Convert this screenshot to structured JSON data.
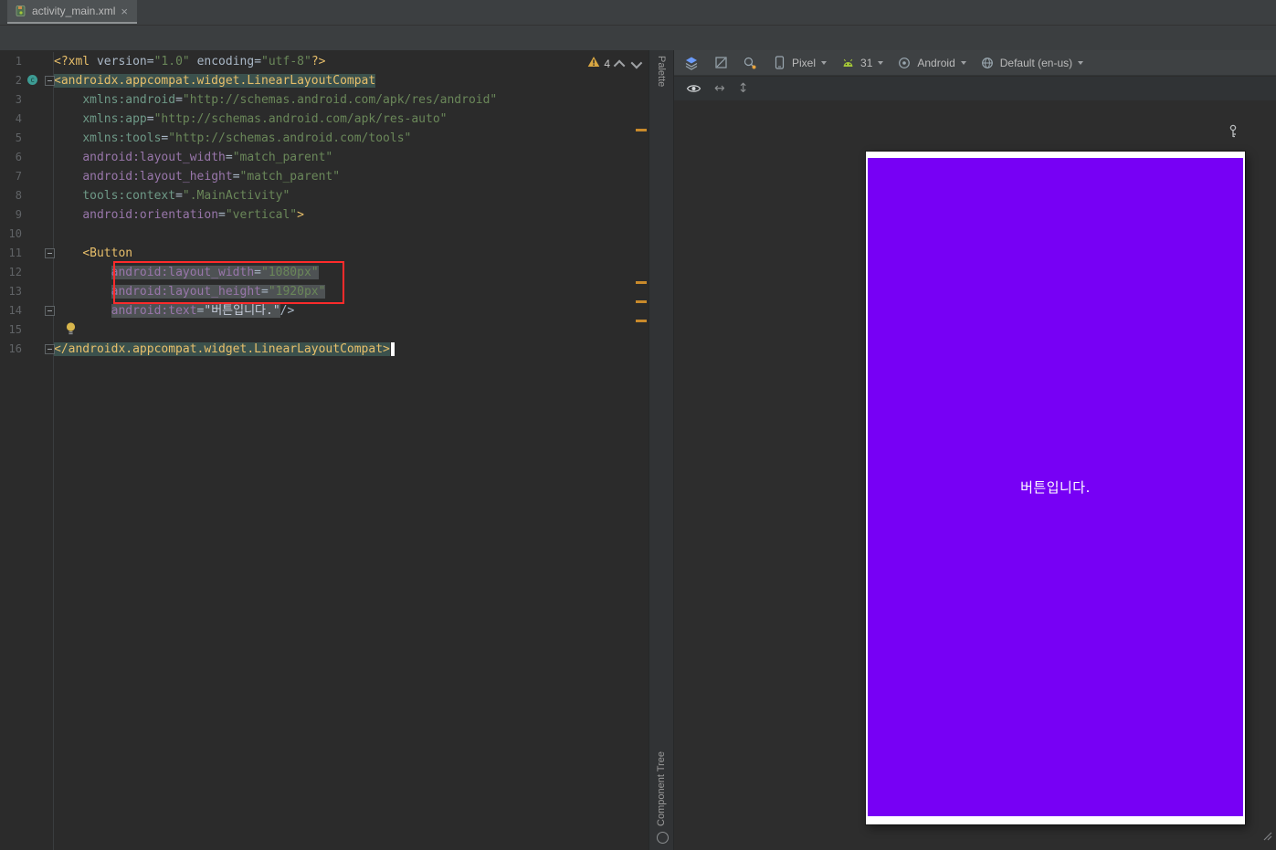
{
  "tab_bar": {
    "tabs": [
      {
        "label": "activity_main.xml",
        "close_glyph": "×"
      }
    ]
  },
  "editor": {
    "warning": {
      "count": "4"
    },
    "fold_lines": [
      2,
      11,
      14,
      16
    ],
    "lines": [
      {
        "n": "1",
        "indent": 0,
        "tokens": [
          [
            "<?xml ",
            "tag"
          ],
          [
            "version",
            "plain"
          ],
          [
            "=",
            "plain"
          ],
          [
            "\"1.0\"",
            "str"
          ],
          [
            " ",
            "plain"
          ],
          [
            "encoding",
            "plain"
          ],
          [
            "=",
            "plain"
          ],
          [
            "\"utf-8\"",
            "str"
          ],
          [
            "?>",
            "tag"
          ]
        ]
      },
      {
        "n": "2",
        "indent": 0,
        "tokens": [
          [
            "<androidx.appcompat.widget.LinearLayoutCompat",
            "tag match"
          ]
        ]
      },
      {
        "n": "3",
        "indent": 4,
        "tokens": [
          [
            "xmlns:android",
            "attrns"
          ],
          [
            "=",
            "plain"
          ],
          [
            "\"http://schemas.android.com/apk/res/android\"",
            "str"
          ]
        ]
      },
      {
        "n": "4",
        "indent": 4,
        "tokens": [
          [
            "xmlns:app",
            "attrns"
          ],
          [
            "=",
            "plain"
          ],
          [
            "\"http://schemas.android.com/apk/res-auto\"",
            "str"
          ]
        ]
      },
      {
        "n": "5",
        "indent": 4,
        "tokens": [
          [
            "xmlns:tools",
            "attrns"
          ],
          [
            "=",
            "plain"
          ],
          [
            "\"http://schemas.android.com/tools\"",
            "str"
          ]
        ]
      },
      {
        "n": "6",
        "indent": 4,
        "tokens": [
          [
            "android:layout_width",
            "attra"
          ],
          [
            "=",
            "plain"
          ],
          [
            "\"match_parent\"",
            "str"
          ]
        ]
      },
      {
        "n": "7",
        "indent": 4,
        "tokens": [
          [
            "android:layout_height",
            "attra"
          ],
          [
            "=",
            "plain"
          ],
          [
            "\"match_parent\"",
            "str"
          ]
        ]
      },
      {
        "n": "8",
        "indent": 4,
        "tokens": [
          [
            "tools:context",
            "attrns"
          ],
          [
            "=",
            "plain"
          ],
          [
            "\".MainActivity\"",
            "str"
          ]
        ]
      },
      {
        "n": "9",
        "indent": 4,
        "tokens": [
          [
            "android:orientation",
            "attra"
          ],
          [
            "=",
            "plain"
          ],
          [
            "\"vertical\"",
            "str"
          ],
          [
            ">",
            "tag"
          ]
        ]
      },
      {
        "n": "10",
        "indent": 0,
        "tokens": []
      },
      {
        "n": "11",
        "indent": 4,
        "tokens": [
          [
            "<Button",
            "tag"
          ]
        ]
      },
      {
        "n": "12",
        "indent": 8,
        "tokens": [
          [
            "android:layout_width",
            "attra hl"
          ],
          [
            "=",
            "plain hl"
          ],
          [
            "\"1080px\"",
            "str hl"
          ]
        ]
      },
      {
        "n": "13",
        "indent": 8,
        "tokens": [
          [
            "android:layout_height",
            "attra hl"
          ],
          [
            "=",
            "plain hl"
          ],
          [
            "\"1920px\"",
            "str hl"
          ]
        ]
      },
      {
        "n": "14",
        "indent": 8,
        "tokens": [
          [
            "android:text",
            "attra hl"
          ],
          [
            "=",
            "plain hl"
          ],
          [
            "\"버튼입니다.\"",
            "val-k hl"
          ],
          [
            "/>",
            "plain"
          ]
        ]
      },
      {
        "n": "15",
        "indent": 0,
        "tokens": []
      },
      {
        "n": "16",
        "indent": 0,
        "tokens": [
          [
            "</androidx.appcompat.widget.LinearLayoutCompat>",
            "tag match"
          ]
        ],
        "caret": true
      }
    ]
  },
  "design": {
    "stripe": {
      "palette_label": "Palette",
      "component_tree_label": "Component Tree"
    },
    "toolbar": {
      "device": {
        "label": "Pixel"
      },
      "api": {
        "label": "31"
      },
      "theme": {
        "label": "Android"
      },
      "locale": {
        "label": "Default (en-us)"
      }
    },
    "preview": {
      "button_text": "버튼입니다.",
      "screen_color": "#7700f5",
      "frame_color": "#ffffff"
    }
  },
  "icons": {
    "tab_file": "android-xml-file-icon",
    "close": "close-icon",
    "warning": "warning-icon",
    "chevron_up": "chevron-up-icon",
    "chevron_down": "chevron-down-icon",
    "class_gutter": "class-gutter-icon",
    "fold": "fold-marker-icon",
    "lightbulb": "lightbulb-icon",
    "layers": "layers-icon",
    "blueprint": "blueprint-icon",
    "color_picker": "color-picker-icon",
    "phone": "phone-icon",
    "android_head": "android-head-icon",
    "theme_circle": "theme-circle-icon",
    "locale_globe": "locale-globe-icon",
    "eye": "eye-icon",
    "swap_horizontal": "swap-horizontal-icon",
    "swap_vertical": "swap-vertical-icon",
    "key": "key-icon",
    "component_tree": "component-tree-icon",
    "resize_grip": "resize-grip-icon"
  },
  "colors": {
    "accent_purple": "#7700f5",
    "editor_bg": "#2b2b2b",
    "tag_yellow": "#e8bf6a",
    "string_green": "#6a8759",
    "attribute_android": "#9876aa",
    "attribute_namespace": "#6e9987",
    "warning_stripe": "#c98a2b",
    "error_box_red": "#ff2b2b",
    "tag_match_bg": "#3b514d",
    "highlight_bg": "#4e5254"
  }
}
